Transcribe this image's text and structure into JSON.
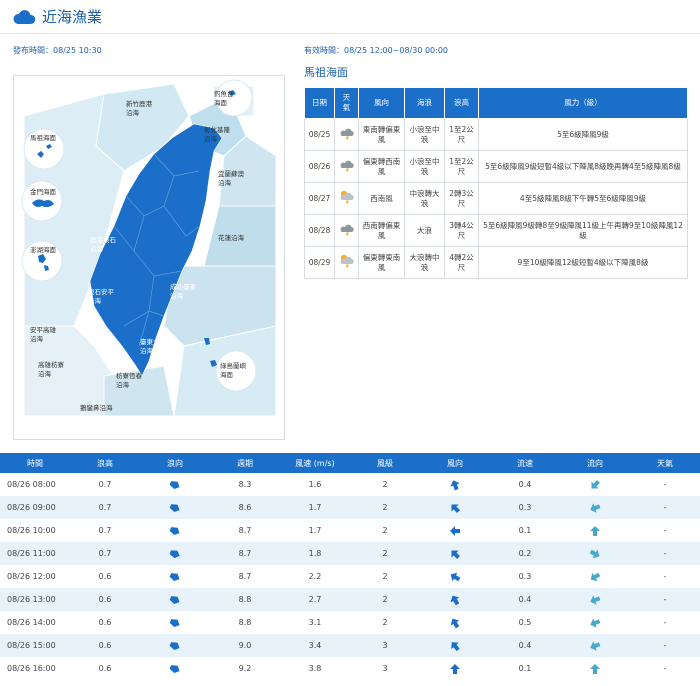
{
  "header": {
    "title": "近海漁業",
    "icon": "cloud-icon"
  },
  "issued": {
    "label": "發布時間：",
    "value": "08/25 10:30"
  },
  "valid": {
    "label": "有效時間：",
    "value": "08/25 12:00~08/30 00:00"
  },
  "region": {
    "title": "馬祖海面"
  },
  "map": {
    "zones": {
      "diaoyutai": "釣魚台\n海面",
      "hsinchu": "新竹鹿港\n沿海",
      "keelung": "彰化基隆\n沿海",
      "matsu": "馬祖海面",
      "kinmen": "金門海面",
      "penghu": "澎湖海面",
      "yilan": "宜蘭蘇澳\n沿海",
      "hualien": "花蓮沿海",
      "lukang": "鹿港東石\n沿海",
      "donghsi": "東石安平\n沿海",
      "chenggong": "成功臺東\n沿海",
      "anping": "安平高雄\n沿海",
      "kaohsiung": "高雄枋寮\n沿海",
      "taitung": "臺東大武\n沿海",
      "lanyu": "綠島蘭嶼\n海面",
      "fangliao": "枋寮恆春\n沿海",
      "eluanbi": "鵝鑾鼻沿海"
    }
  },
  "forecast": {
    "headers": [
      "日期",
      "天\n氣",
      "風向",
      "海浪",
      "浪高",
      "風力（級）"
    ],
    "rows": [
      {
        "date": "08/25",
        "weather": "cloudy-thunder-icon",
        "wind_dir": "東南轉偏東風",
        "wave": "小浪至中浪",
        "height": "1至2公尺",
        "force": "5至6級陣風9級"
      },
      {
        "date": "08/26",
        "weather": "cloudy-thunder-icon",
        "wind_dir": "偏東轉西南風",
        "wave": "小浪至中浪",
        "height": "1至2公尺",
        "force": "5至6級陣風9級短暫4級以下陣風8級晚再轉4至5級陣風8級"
      },
      {
        "date": "08/27",
        "weather": "sun-cloud-thunder-icon",
        "wind_dir": "西南風",
        "wave": "中浪轉大浪",
        "height": "2轉3公尺",
        "force": "4至5級陣風8級下午轉5至6級陣風9級"
      },
      {
        "date": "08/28",
        "weather": "cloudy-thunder-icon",
        "wind_dir": "西南轉偏東風",
        "wave": "大浪",
        "height": "3轉4公尺",
        "force": "5至6級陣風9級轉8至9級陣風11級上午再轉9至10級陣風12級"
      },
      {
        "date": "08/29",
        "weather": "sun-cloud-thunder-icon",
        "wind_dir": "偏東轉東南風",
        "wave": "大浪轉中浪",
        "height": "4轉2公尺",
        "force": "9至10級陣風12級短暫4級以下陣風8級"
      }
    ]
  },
  "observations": {
    "headers": [
      "時間",
      "浪高",
      "浪向",
      "週期",
      "風速 (m/s)",
      "風級",
      "風向",
      "流速",
      "流向",
      "天氣"
    ],
    "colors": {
      "wave_arrow": "#1b6fc8",
      "wind_arrow": "#1b6fc8",
      "current_arrow": "#4aa8c8",
      "header": "#1b6fc8",
      "stripe": "#e8f2fb"
    },
    "rows": [
      {
        "time": "08/26 08:00",
        "wave_h": "0.7",
        "wave_dir": 25,
        "period": "8.3",
        "wind_speed": "1.6",
        "wind_level": "2",
        "wind_dir": 340,
        "cur_speed": "0.4",
        "cur_dir": 225,
        "weather": "-"
      },
      {
        "time": "08/26 09:00",
        "wave_h": "0.7",
        "wave_dir": 25,
        "period": "8.6",
        "wind_speed": "1.7",
        "wind_level": "2",
        "wind_dir": 315,
        "cur_speed": "0.3",
        "cur_dir": 250,
        "weather": "-"
      },
      {
        "time": "08/26 10:00",
        "wave_h": "0.7",
        "wave_dir": 25,
        "period": "8.7",
        "wind_speed": "1.7",
        "wind_level": "2",
        "wind_dir": 270,
        "cur_speed": "0.1",
        "cur_dir": 0,
        "weather": "-"
      },
      {
        "time": "08/26 11:00",
        "wave_h": "0.7",
        "wave_dir": 20,
        "period": "8.7",
        "wind_speed": "1.8",
        "wind_level": "2",
        "wind_dir": 315,
        "cur_speed": "0.2",
        "cur_dir": 120,
        "weather": "-"
      },
      {
        "time": "08/26 12:00",
        "wave_h": "0.6",
        "wave_dir": 25,
        "period": "8.7",
        "wind_speed": "2.2",
        "wind_level": "2",
        "wind_dir": 300,
        "cur_speed": "0.3",
        "cur_dir": 240,
        "weather": "-"
      },
      {
        "time": "08/26 13:00",
        "wave_h": "0.6",
        "wave_dir": 25,
        "period": "8.8",
        "wind_speed": "2.7",
        "wind_level": "2",
        "wind_dir": 330,
        "cur_speed": "0.4",
        "cur_dir": 250,
        "weather": "-"
      },
      {
        "time": "08/26 14:00",
        "wave_h": "0.6",
        "wave_dir": 25,
        "period": "8.8",
        "wind_speed": "3.1",
        "wind_level": "2",
        "wind_dir": 330,
        "cur_speed": "0.5",
        "cur_dir": 250,
        "weather": "-"
      },
      {
        "time": "08/26 15:00",
        "wave_h": "0.6",
        "wave_dir": 25,
        "period": "9.0",
        "wind_speed": "3.4",
        "wind_level": "3",
        "wind_dir": 320,
        "cur_speed": "0.4",
        "cur_dir": 250,
        "weather": "-"
      },
      {
        "time": "08/26 16:00",
        "wave_h": "0.6",
        "wave_dir": 25,
        "period": "9.2",
        "wind_speed": "3.8",
        "wind_level": "3",
        "wind_dir": 0,
        "cur_speed": "0.1",
        "cur_dir": 0,
        "weather": "-"
      }
    ]
  }
}
